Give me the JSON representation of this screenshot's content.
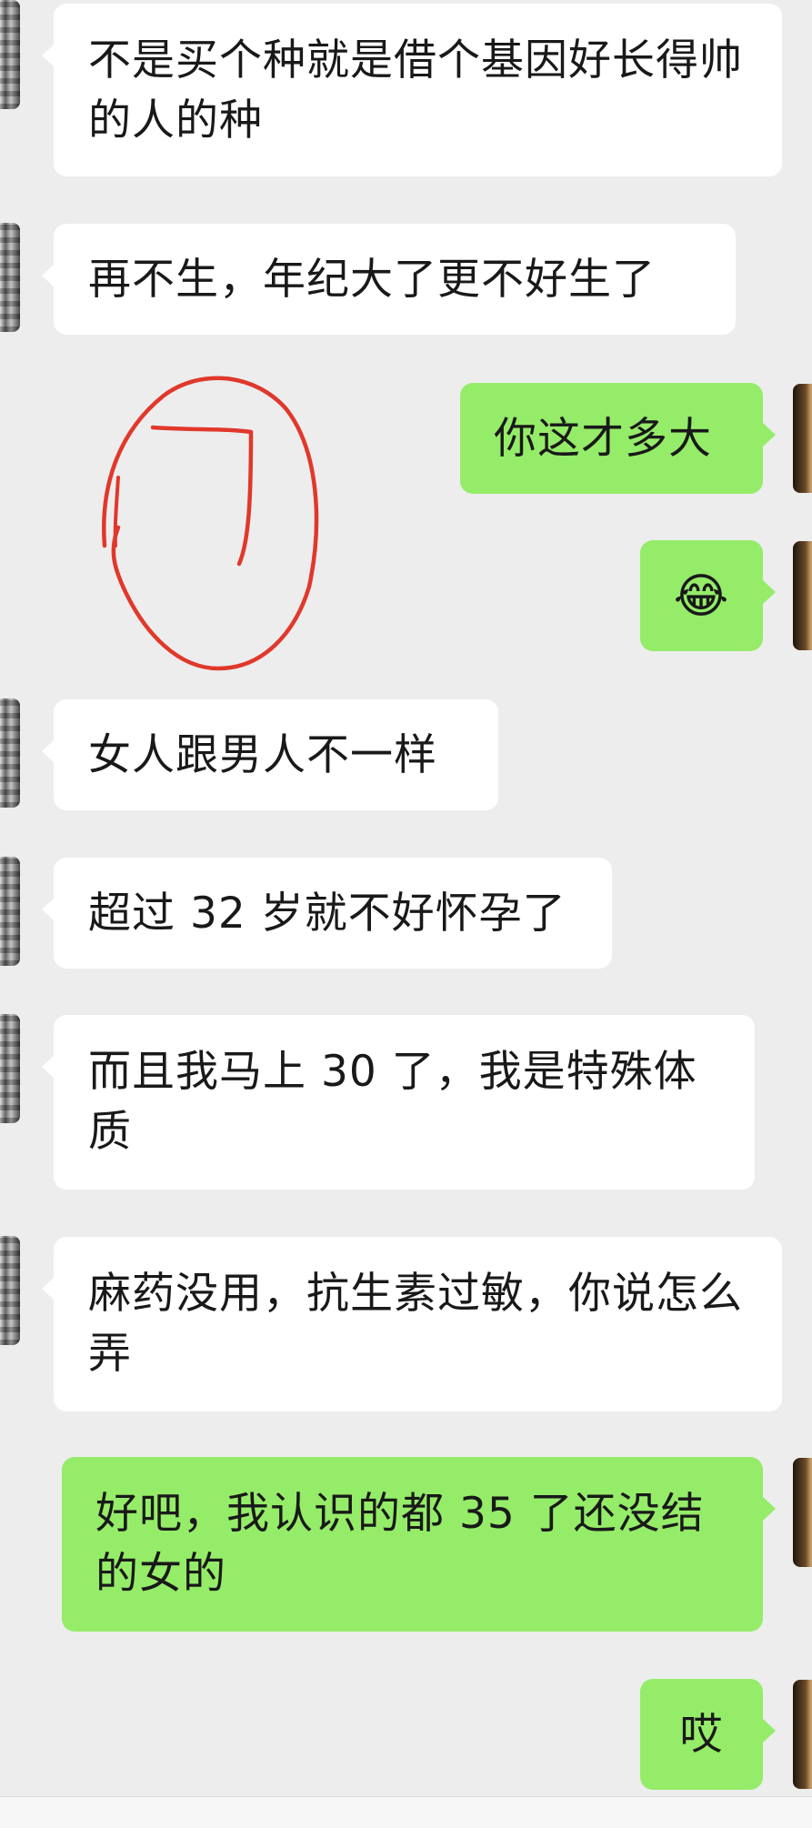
{
  "messages": [
    {
      "side": "in",
      "text": "不是买个种就是借个基因好长得帅的人的种"
    },
    {
      "side": "in",
      "text": "再不生，年纪大了更不好生了"
    },
    {
      "side": "out",
      "text": "你这才多大"
    },
    {
      "side": "out",
      "text": "😂"
    },
    {
      "side": "in",
      "text": "女人跟男人不一样"
    },
    {
      "side": "in",
      "text": "超过 32 岁就不好怀孕了"
    },
    {
      "side": "in",
      "text": "而且我马上 30 了，我是特殊体质"
    },
    {
      "side": "in",
      "text": "麻药没用，抗生素过敏，你说怎么弄"
    },
    {
      "side": "out",
      "text": "好吧，我认识的都 35 了还没结的女的"
    },
    {
      "side": "out",
      "text": "哎"
    }
  ],
  "colors": {
    "background": "#ededed",
    "incoming_bubble": "#ffffff",
    "outgoing_bubble": "#95ec69",
    "annotation_stroke": "#e0382b"
  }
}
